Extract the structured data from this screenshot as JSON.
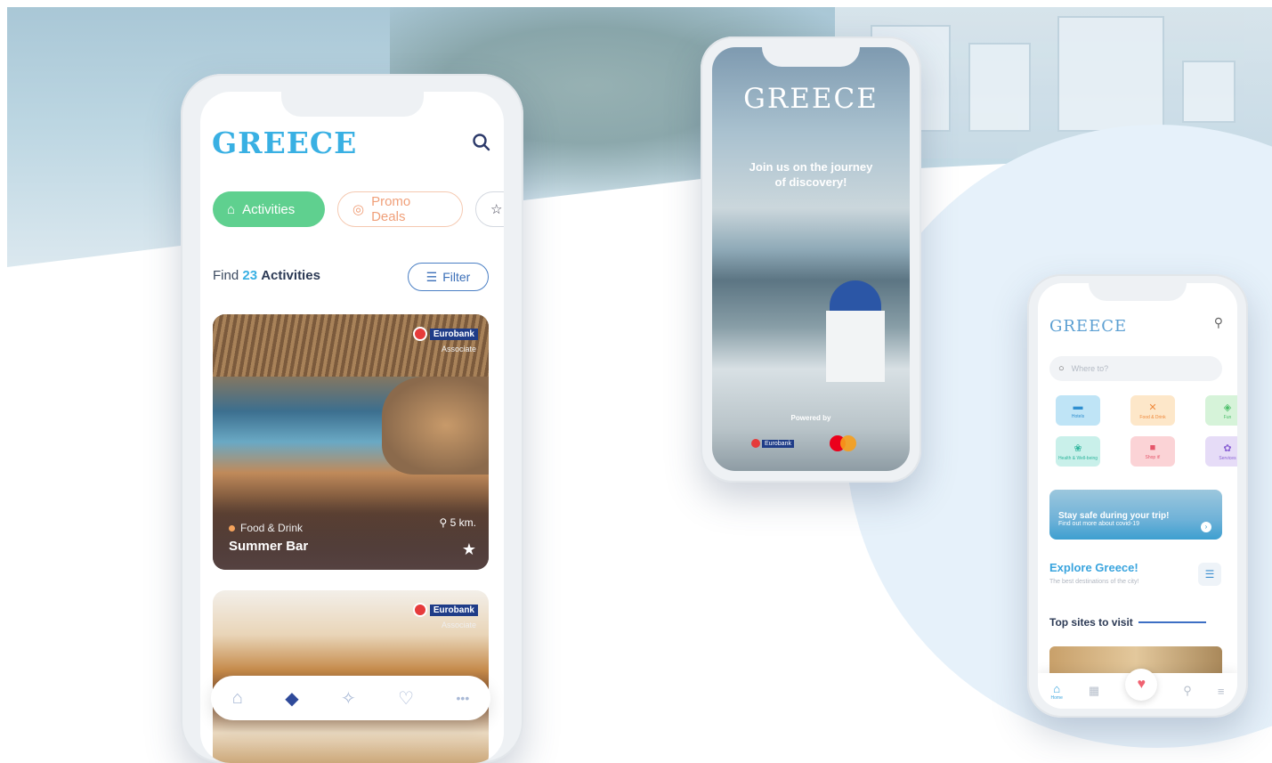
{
  "colors": {
    "brand_blue": "#39b0e3",
    "activities_green": "#5fd08f",
    "promo_orange": "#f0a07a",
    "eurobank_navy": "#1f3c88",
    "eurobank_red": "#e63b3b"
  },
  "phone1": {
    "logo": "GREECE",
    "search_icon": "search-icon",
    "chips": [
      {
        "label": "Activities",
        "icon": "bank-icon"
      },
      {
        "label": "Promo Deals",
        "icon": "tag-icon"
      },
      {
        "label": "",
        "icon": "star-icon"
      }
    ],
    "find": {
      "prefix": "Find",
      "count": "23",
      "suffix": "Activities"
    },
    "filter_label": "Filter",
    "cards": [
      {
        "badge": "Eurobank",
        "badge_sub": "Associate",
        "category": "Food & Drink",
        "title": "Summer Bar",
        "distance": "5 km."
      },
      {
        "badge": "Eurobank",
        "badge_sub": "Associate"
      }
    ],
    "tabbar": [
      "home-icon",
      "diamond-icon",
      "puzzle-icon",
      "heart-icon",
      "more-icon"
    ]
  },
  "phone2": {
    "logo": "GREECE",
    "tagline_line1": "Join us on the journey",
    "tagline_line2": "of discovery!",
    "powered_by": "Powered by",
    "sponsor": "Eurobank"
  },
  "phone3": {
    "logo": "GREECE",
    "search_placeholder": "Where to?",
    "tiles": [
      {
        "label": "Hotels",
        "color": "#bfe4f6",
        "fg": "#2f8fd0",
        "icon": "bed-icon"
      },
      {
        "label": "Food & Drink",
        "color": "#fde7c9",
        "fg": "#f08a3c",
        "icon": "cutlery-icon"
      },
      {
        "label": "Fun",
        "color": "#d6f3d9",
        "fg": "#4cbf6a",
        "icon": "ticket-icon"
      },
      {
        "label": "Health & Well-being",
        "color": "#c9f0ea",
        "fg": "#2fb59d",
        "icon": "lotus-icon"
      },
      {
        "label": "Shop it!",
        "color": "#fbd3d6",
        "fg": "#e5566a",
        "icon": "bag-icon"
      },
      {
        "label": "Services",
        "color": "#e6dcf7",
        "fg": "#8a62d4",
        "icon": "gear-icon"
      }
    ],
    "promo_title": "Stay safe during your trip!",
    "promo_sub": "Find out more about covid-19",
    "explore_title": "Explore Greece!",
    "explore_sub": "The best destinations of the city!",
    "top_sites": "Top sites to visit",
    "nav_home": "Home"
  }
}
